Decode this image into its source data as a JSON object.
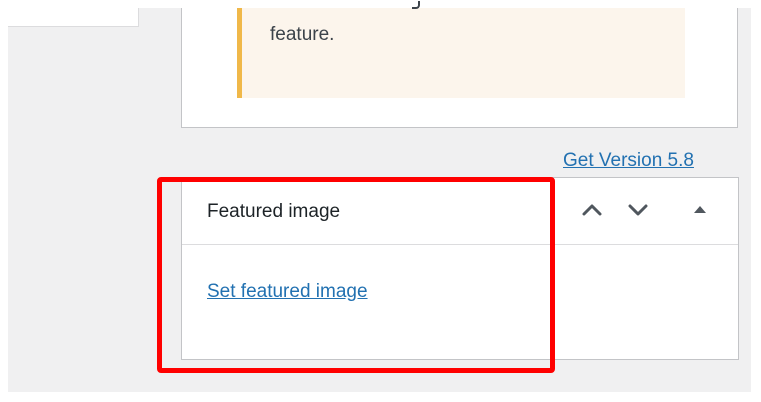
{
  "notice": {
    "text": "feature."
  },
  "header_link": {
    "label": "Get Version 5.8"
  },
  "featured_panel": {
    "title": "Featured image",
    "set_link": "Set featured image",
    "controls": [
      {
        "name": "move-up",
        "icon": "chevron-up-icon"
      },
      {
        "name": "move-down",
        "icon": "chevron-down-icon"
      },
      {
        "name": "toggle-panel",
        "icon": "triangle-up-icon"
      }
    ]
  },
  "colors": {
    "link": "#2271b1",
    "notice_bg": "#fcf5ec",
    "notice_border": "#f0b849",
    "highlight": "#ff0000",
    "page_bg": "#f0f0f1"
  }
}
